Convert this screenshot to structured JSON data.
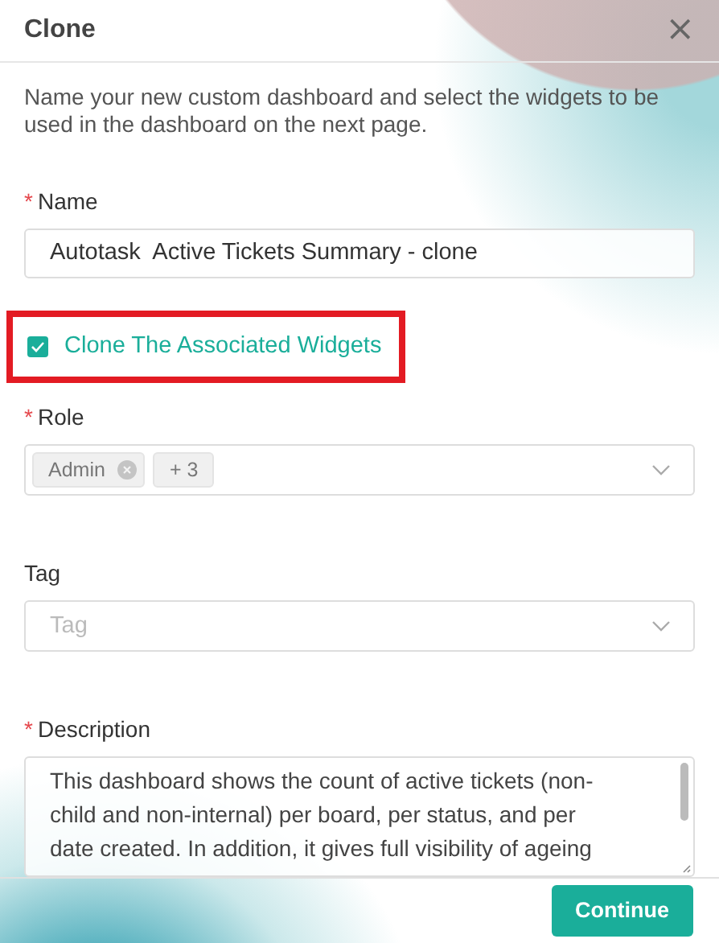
{
  "dialog": {
    "title": "Clone",
    "close": "×"
  },
  "required_mark": "*",
  "intro": "Name your new custom dashboard and select the widgets to be used in the dashboard on the next page.",
  "name_field": {
    "label": "Name",
    "required": true,
    "value": "Autotask  Active Tickets Summary - clone"
  },
  "clone_widgets": {
    "label": "Clone The Associated Widgets",
    "checked": true,
    "highlighted": true
  },
  "role_field": {
    "label": "Role",
    "required": true,
    "tags": [
      "Admin"
    ],
    "more": "+ 3"
  },
  "tag_field": {
    "label": "Tag",
    "required": false,
    "placeholder": "Tag"
  },
  "description_field": {
    "label": "Description",
    "required": true,
    "value": "This dashboard shows the count of active tickets (non-child and non-internal) per board, per status, and per date created. In addition, it gives full visibility of ageing"
  },
  "buttons": [
    {
      "label": "Continue",
      "kind": "primary"
    }
  ]
}
